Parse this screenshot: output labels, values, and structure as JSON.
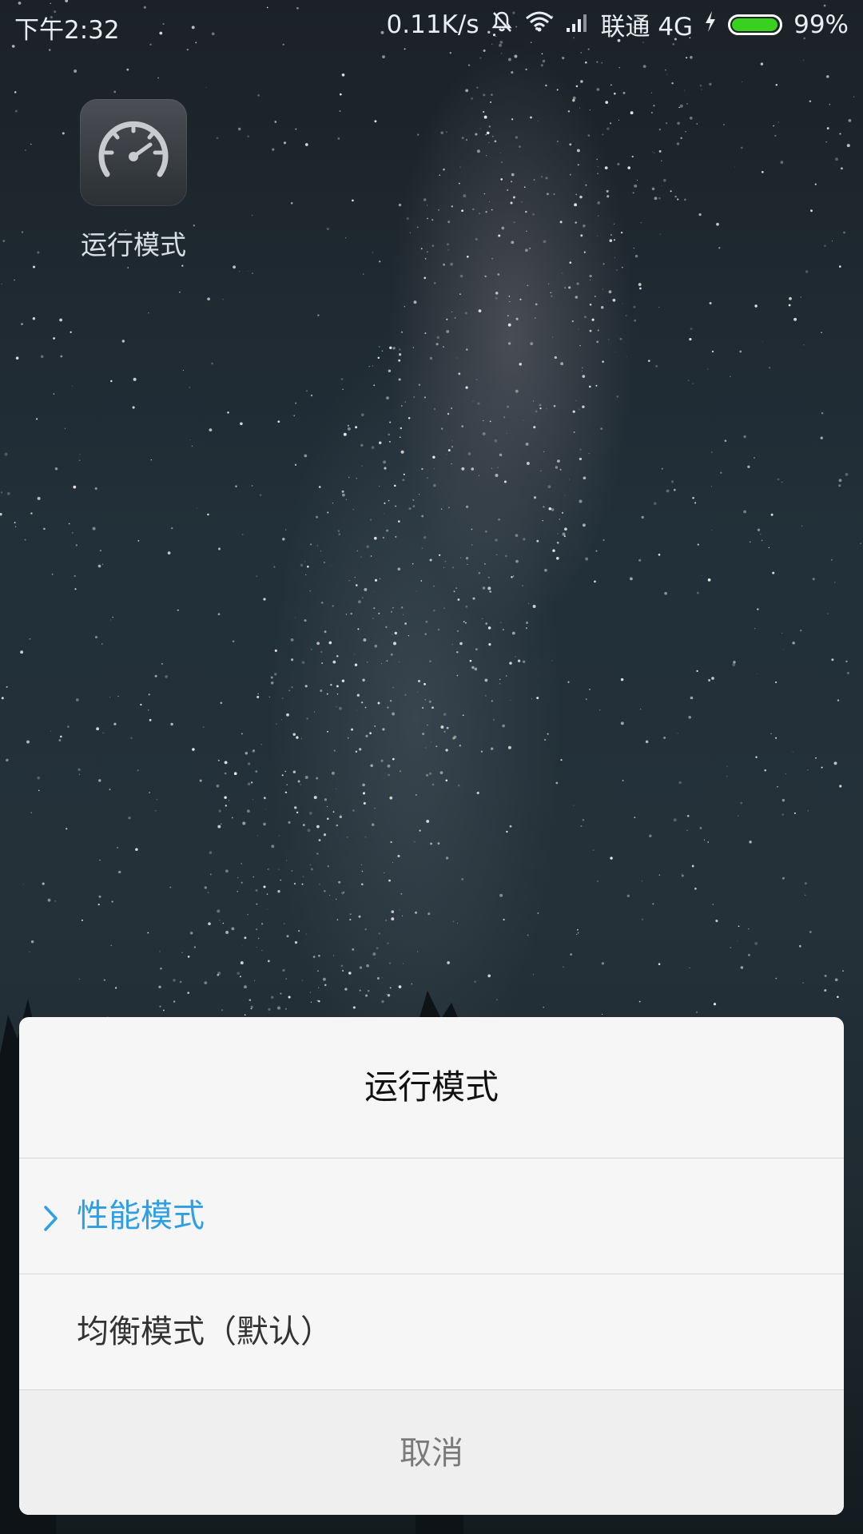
{
  "status_bar": {
    "time": "下午2:32",
    "network_speed": "0.11K/s",
    "carrier": "联通 4G",
    "battery_percent": "99%",
    "battery_level": 0.99,
    "icons": [
      "mute-bell-icon",
      "wifi-icon",
      "signal-icon",
      "charging-icon",
      "battery-icon"
    ]
  },
  "home": {
    "app_label": "运行模式",
    "app_icon": "speedometer-icon"
  },
  "dialog": {
    "title": "运行模式",
    "options": [
      {
        "label": "性能模式",
        "selected": true
      },
      {
        "label": "均衡模式（默认）",
        "selected": false
      }
    ],
    "cancel_label": "取消",
    "accent_color": "#2d9fe6"
  }
}
